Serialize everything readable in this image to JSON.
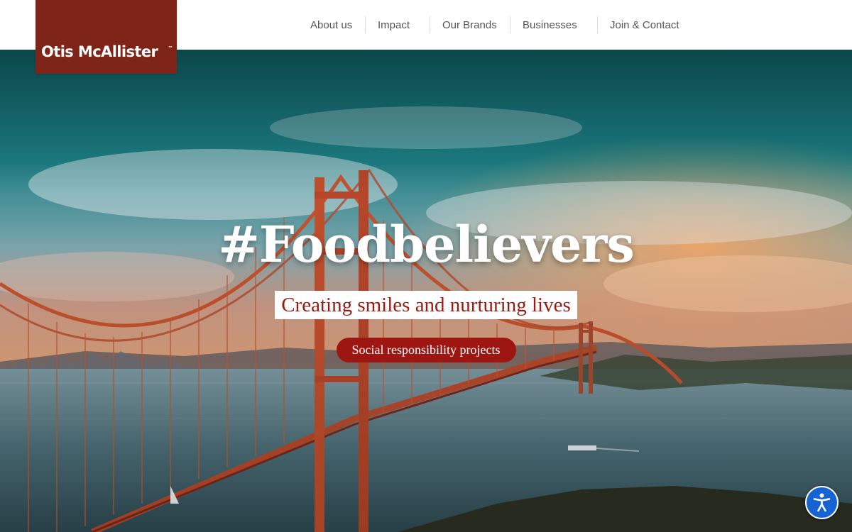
{
  "brand": {
    "name": "Otis McAllister",
    "trademark": "™",
    "color": "#7e2418"
  },
  "nav": {
    "items": [
      {
        "label": "About us"
      },
      {
        "label": "Impact"
      },
      {
        "label": "Our Brands"
      },
      {
        "label": "Businesses"
      },
      {
        "label": "Join & Contact"
      }
    ]
  },
  "hero": {
    "headline": "#Foodbelievers",
    "subheadline": "Creating smiles and nurturing lives",
    "cta_label": "Social responsibility projects",
    "cta_color": "#9d1611",
    "image": "golden-gate-bridge-sunset"
  },
  "accessibility": {
    "icon": "accessibility-icon",
    "color": "#1663d4"
  }
}
